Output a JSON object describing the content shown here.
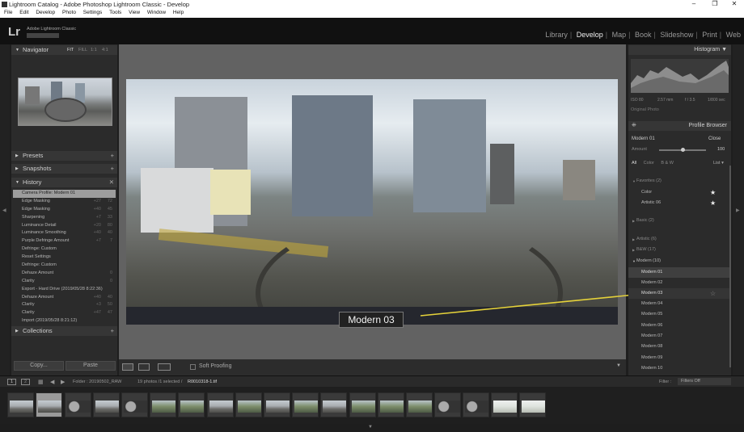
{
  "window": {
    "title": "Lightroom Catalog - Adobe Photoshop Lightroom Classic - Develop",
    "controls": [
      "–",
      "❐",
      "✕"
    ]
  },
  "menu": [
    "File",
    "Edit",
    "Develop",
    "Photo",
    "Settings",
    "Tools",
    "View",
    "Window",
    "Help"
  ],
  "identity": {
    "logo": "Lr",
    "app_name": "Adobe Lightroom Classic"
  },
  "modules": [
    {
      "label": "Library",
      "active": false
    },
    {
      "label": "Develop",
      "active": true
    },
    {
      "label": "Map",
      "active": false
    },
    {
      "label": "Book",
      "active": false
    },
    {
      "label": "Slideshow",
      "active": false
    },
    {
      "label": "Print",
      "active": false
    },
    {
      "label": "Web",
      "active": false
    }
  ],
  "left": {
    "navigator": {
      "title": "Navigator",
      "options": [
        "FIT",
        "FILL",
        "1:1",
        "4:1"
      ]
    },
    "presets": "Presets",
    "snapshots": "Snapshots",
    "history": {
      "title": "History",
      "items": [
        {
          "label": "Camera Profile: Modern 01",
          "v1": "",
          "v2": "",
          "selected": true
        },
        {
          "label": "Edge Masking",
          "v1": "+27",
          "v2": "72"
        },
        {
          "label": "Edge Masking",
          "v1": "+40",
          "v2": "45"
        },
        {
          "label": "Sharpening",
          "v1": "+7",
          "v2": "33"
        },
        {
          "label": "Luminance Detail",
          "v1": "+20",
          "v2": "80"
        },
        {
          "label": "Luminance Smoothing",
          "v1": "+40",
          "v2": "40"
        },
        {
          "label": "Purple Defringe Amount",
          "v1": "+7",
          "v2": "7"
        },
        {
          "label": "Defringe: Custom",
          "v1": "",
          "v2": ""
        },
        {
          "label": "Reset Settings",
          "v1": "",
          "v2": ""
        },
        {
          "label": "Defringe: Custom",
          "v1": "",
          "v2": ""
        },
        {
          "label": "Dehaze Amount",
          "v1": "",
          "v2": "0"
        },
        {
          "label": "Clarity",
          "v1": "",
          "v2": "0"
        },
        {
          "label": "Export - Hard Drive (2019/05/28 8:22:36)",
          "v1": "",
          "v2": ""
        },
        {
          "label": "Dehaze Amount",
          "v1": "+40",
          "v2": "40"
        },
        {
          "label": "Clarity",
          "v1": "+3",
          "v2": "50"
        },
        {
          "label": "Clarity",
          "v1": "+47",
          "v2": "47"
        },
        {
          "label": "Import (2019/05/28 8:21:12)",
          "v1": "",
          "v2": ""
        }
      ]
    },
    "collections": "Collections",
    "copy_label": "Copy...",
    "paste_label": "Paste"
  },
  "center": {
    "profile_overlay": "Modern 03",
    "soft_proofing": "Soft Proofing"
  },
  "right": {
    "histogram": {
      "title": "Histogram",
      "info": [
        "ISO 80",
        "2.57 mm",
        "f / 3.5",
        "1/800 sec"
      ],
      "original_photo": "Original Photo"
    },
    "profile_browser": {
      "title": "Profile Browser",
      "current": "Modern 01",
      "close": "Close",
      "amount_label": "Amount",
      "amount": 100,
      "tabs": [
        {
          "label": "All",
          "on": true
        },
        {
          "label": "Color",
          "on": false
        },
        {
          "label": "B & W",
          "on": false
        }
      ],
      "list_mode": "List",
      "favorites": "Favorites (2)",
      "fav_items": [
        "Color",
        "Artistic 06"
      ],
      "basic": "Basic (2)",
      "artistic": "Artistic (6)",
      "bw": "B&W (17)",
      "modern": "Modern (10)",
      "modern_items": [
        "Modern 01",
        "Modern 02",
        "Modern 03",
        "Modern 04",
        "Modern 05",
        "Modern 06",
        "Modern 07",
        "Modern 08",
        "Modern 09",
        "Modern 10"
      ],
      "selected_item": "Modern 01",
      "hovered_item": "Modern 03"
    }
  },
  "filmstrip": {
    "pages": [
      "1",
      "2"
    ],
    "folder": "Folder : 20190502_RAW",
    "count": "19 photos /1 selected /",
    "file": "R0010318-1.tif",
    "filter_label": "Filter :",
    "filter_value": "Filters Off",
    "thumb_count": 19,
    "selected_index": 1
  },
  "colors": {
    "accent_line": "#e5d23a",
    "panel": "#2b2b2b",
    "background": "#1e1e1e"
  },
  "icons": [
    "triangle-right-icon",
    "triangle-down-icon",
    "plus-icon",
    "close-icon",
    "star-icon",
    "grid-icon",
    "chevron-down-icon"
  ]
}
